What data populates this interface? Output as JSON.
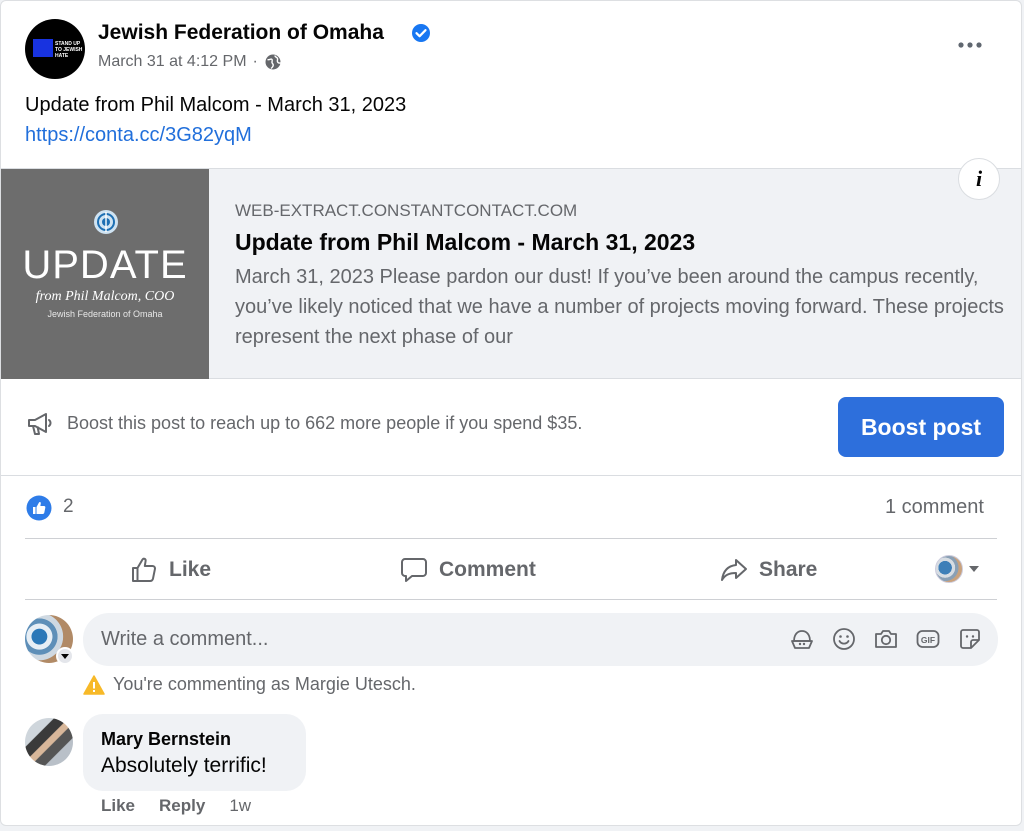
{
  "post": {
    "page_name": "Jewish Federation of Omaha",
    "timestamp": "March 31 at 4:12 PM",
    "separator": "·",
    "avatar_text": "STAND UP TO JEWISH HATE",
    "text": "Update from Phil Malcom - March 31, 2023",
    "link": "https://conta.cc/3G82yqM"
  },
  "preview": {
    "thumb_title": "UPDATE",
    "thumb_from": "from Phil Malcom, COO",
    "thumb_org": "Jewish Federation of Omaha",
    "domain": "WEB-EXTRACT.CONSTANTCONTACT.COM",
    "title": "Update from Phil Malcom - March 31, 2023",
    "description": "March 31, 2023 Please pardon our dust! If you’ve been around the campus recently, you’ve likely noticed that we have a number of projects moving forward. These projects represent the next phase of our",
    "info": "i"
  },
  "boost": {
    "text": "Boost this post to reach up to 662 more people if you spend $35.",
    "button": "Boost post"
  },
  "stats": {
    "likes": "2",
    "comments": "1 comment"
  },
  "actions": {
    "like": "Like",
    "comment": "Comment",
    "share": "Share"
  },
  "composer": {
    "placeholder": "Write a comment...",
    "warning": "You're commenting as Margie Utesch."
  },
  "comments": [
    {
      "author": "Mary Bernstein",
      "text": "Absolutely terrific!",
      "like": "Like",
      "reply": "Reply",
      "age": "1w"
    }
  ],
  "colors": {
    "accent": "#2d6fdc",
    "link": "#216fdb",
    "secondary_text": "#65676b",
    "warning": "#f7b928"
  }
}
